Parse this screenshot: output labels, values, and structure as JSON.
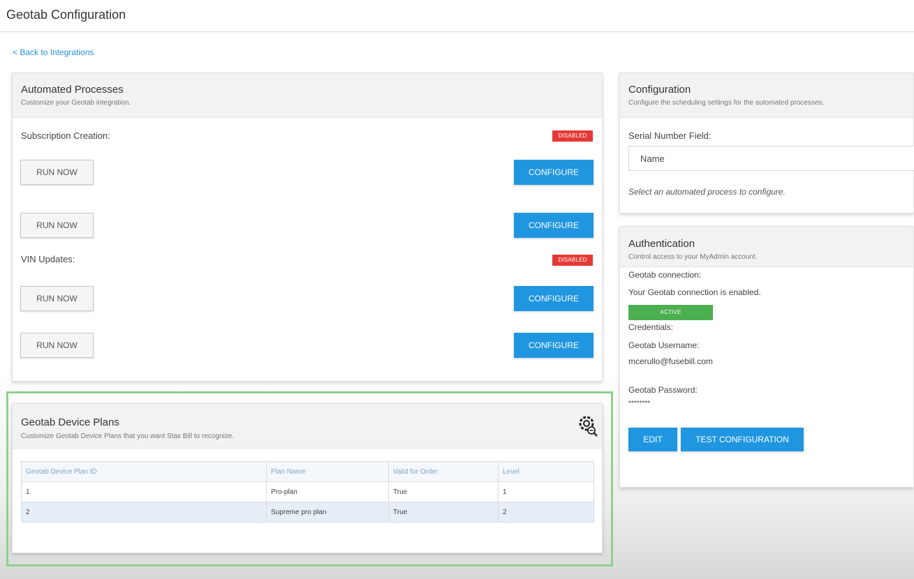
{
  "window": {
    "title": "Geotab Configuration"
  },
  "nav": {
    "back_label": "< Back to Integrations"
  },
  "automated": {
    "title": "Automated Processes",
    "subtitle": "Customize your Geotab integration.",
    "subscription_label": "Subscription Creation:",
    "subscription_status": "DISABLED",
    "vin_label": "VIN Updates:",
    "vin_status": "DISABLED",
    "run_label": "RUN NOW",
    "configure_label": "CONFIGURE"
  },
  "configuration": {
    "title": "Configuration",
    "subtitle": "Configure the scheduling settings for the automated processes.",
    "serial_label": "Serial Number Field:",
    "serial_value": "Name",
    "hint": "Select an automated process to configure."
  },
  "authentication": {
    "title": "Authentication",
    "subtitle": "Control access to your MyAdmin account.",
    "connection_label": "Geotab connection:",
    "connection_text": "Your Geotab connection is enabled.",
    "status": "ACTIVE",
    "credentials_label": "Credentials:",
    "username_label": "Geotab Username:",
    "username_value": "mcerullo@fusebill.com",
    "password_label": "Geotab Password:",
    "password_value": "********",
    "edit_label": "EDIT",
    "test_label": "TEST CONFIGURATION"
  },
  "plans": {
    "title": "Geotab Device Plans",
    "subtitle": "Customize Geotab Device Plans that you want Stax Bill to recognize.",
    "columns": [
      "Geotab Device Plan ID",
      "Plan Name",
      "Valid for Order",
      "Level"
    ],
    "rows": [
      [
        "1",
        "Pro-plan",
        "True",
        "1"
      ],
      [
        "2",
        "Supreme pro plan",
        "True",
        "2"
      ]
    ]
  },
  "colors": {
    "accent": "#2196e0",
    "disabled": "#e53935",
    "active": "#4caf50",
    "highlight": "#8fd18f"
  },
  "icons": {
    "plans_action": "gear-search-icon"
  }
}
